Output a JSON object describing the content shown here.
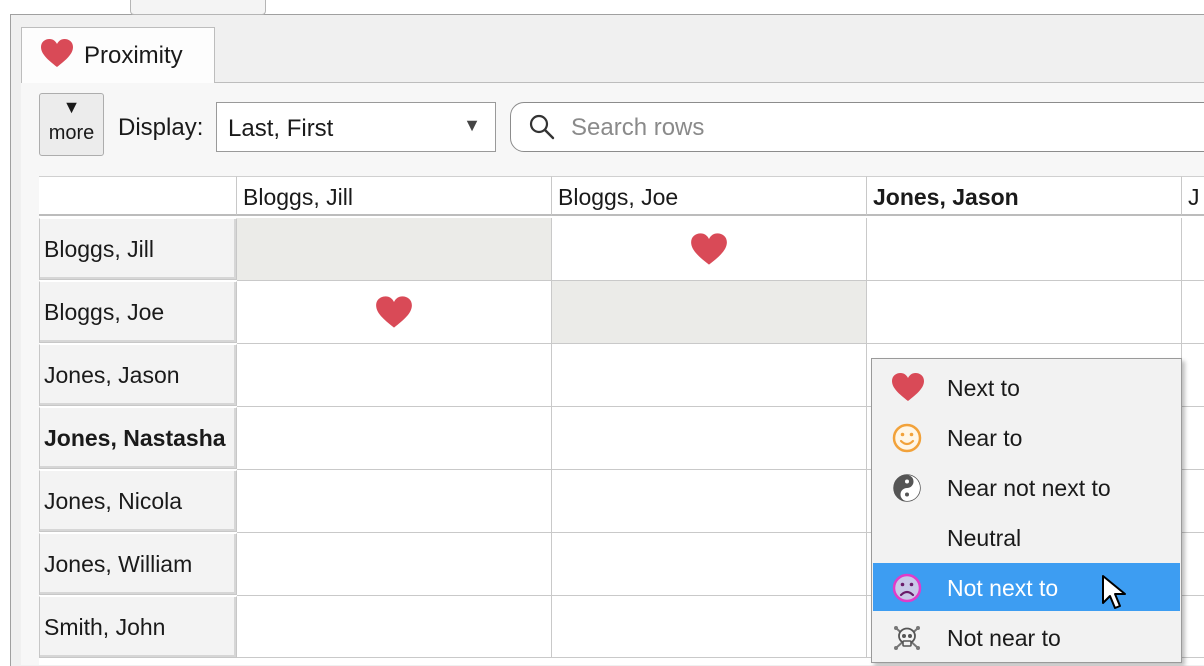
{
  "tab": {
    "label": "Proximity",
    "icon": "heart-icon"
  },
  "toolbar": {
    "more_arrow": "▼",
    "more_label": "more",
    "display_label": "Display:",
    "display_value": "Last, First",
    "search_placeholder": "Search rows"
  },
  "grid": {
    "columns": [
      "Bloggs, Jill",
      "Bloggs, Joe",
      "Jones, Jason",
      "J"
    ],
    "rows": [
      "Bloggs, Jill",
      "Bloggs, Joe",
      "Jones, Jason",
      "Jones, Nastasha",
      "Jones, Nicola",
      "Jones, William",
      "Smith, John"
    ],
    "bold_column": "Jones, Jason",
    "bold_row": "Jones, Nastasha",
    "hearts": [
      {
        "row": "Bloggs, Jill",
        "column": "Bloggs, Joe",
        "value": "Next to"
      },
      {
        "row": "Bloggs, Joe",
        "column": "Bloggs, Jill",
        "value": "Next to"
      }
    ]
  },
  "menu": {
    "items": [
      {
        "label": "Next to",
        "icon": "heart-icon"
      },
      {
        "label": "Near to",
        "icon": "smiley-icon"
      },
      {
        "label": "Near not next to",
        "icon": "yin-yang-icon"
      },
      {
        "label": "Neutral",
        "icon": ""
      },
      {
        "label": "Not next to",
        "icon": "sad-face-icon",
        "highlighted": true
      },
      {
        "label": "Not near to",
        "icon": "skull-crossbones-icon"
      }
    ]
  },
  "colors": {
    "heart": "#d94a57",
    "highlight": "#3d9df2",
    "smiley": "#f2a23a",
    "sad": "#e03cc9"
  }
}
